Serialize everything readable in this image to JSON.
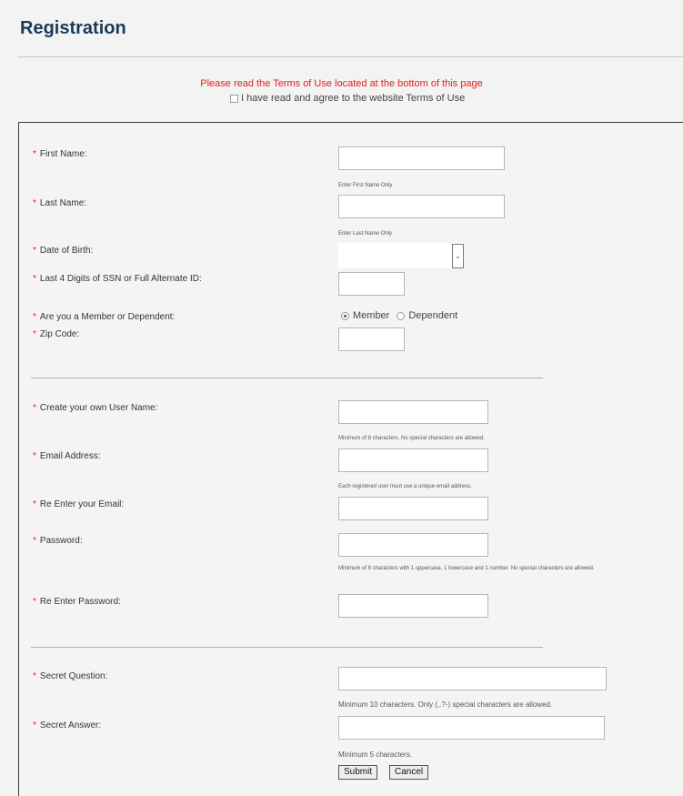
{
  "header": {
    "title": "Registration"
  },
  "terms": {
    "notice": "Please read the Terms of Use located at the bottom of this page",
    "agree_label": "I have read and agree to the website Terms of Use"
  },
  "required_marker": "*",
  "fields": {
    "first_name": {
      "label": "First Name:",
      "hint": "Enter First Name Only"
    },
    "last_name": {
      "label": "Last Name:",
      "hint": "Enter Last Name Only"
    },
    "dob": {
      "label": "Date of Birth:",
      "icon": "chevron-down-icon"
    },
    "ssn": {
      "label": "Last 4 Digits of SSN or Full Alternate ID:"
    },
    "member_type": {
      "label": "Are you a Member or Dependent:",
      "options": [
        "Member",
        "Dependent"
      ],
      "selected": "Member"
    },
    "zip": {
      "label": "Zip Code:"
    },
    "username": {
      "label": "Create your own User Name:",
      "hint": "Minimum of 8 characters. No special characters are allowed."
    },
    "email": {
      "label": "Email Address:",
      "hint": "Each registered user must use a unique email address."
    },
    "email_confirm": {
      "label": "Re Enter your Email:"
    },
    "password": {
      "label": "Password:",
      "hint": "Minimum of 8 characters with 1 uppercase, 1 lowercase and 1 number. No special characters are allowed."
    },
    "password_confirm": {
      "label": "Re Enter Password:"
    },
    "secret_question": {
      "label": "Secret Question:",
      "hint": "Minimum 10 characters. Only (,.?-) special characters are allowed."
    },
    "secret_answer": {
      "label": "Secret Answer:",
      "hint": "Minimum 5 characters."
    }
  },
  "buttons": {
    "submit": "Submit",
    "cancel": "Cancel"
  },
  "colors": {
    "required": "#e0201a",
    "title": "#1a3a5a",
    "notice": "#e0201a"
  }
}
